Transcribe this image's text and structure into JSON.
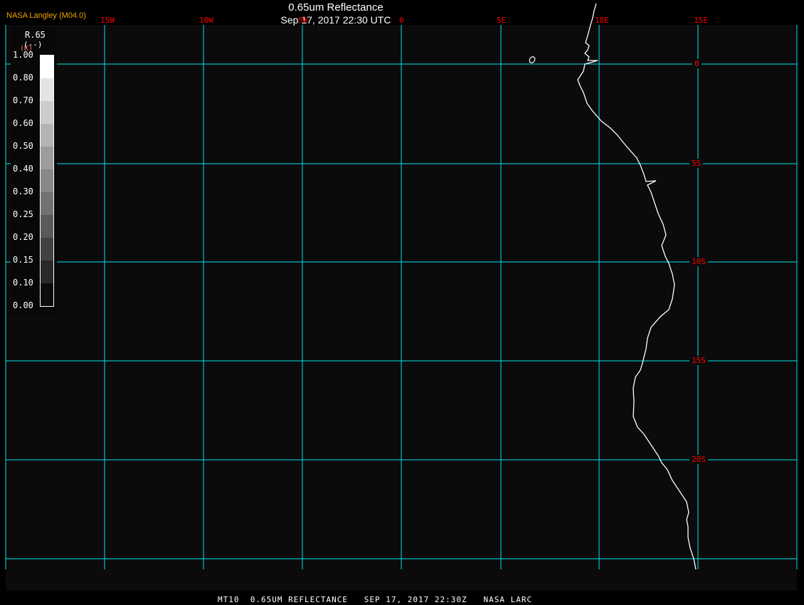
{
  "header": {
    "title": "0.65um Reflectance",
    "subtitle": "Sep 17, 2017 22:30 UTC",
    "brand": "NASA Langley (M04.0)"
  },
  "longitude_labels": [
    "15W",
    "10W",
    "5W",
    "0",
    "5E",
    "10E",
    "15E"
  ],
  "latitude_labels": [
    "0",
    "5S",
    "10S",
    "15S",
    "20S"
  ],
  "colorbar": {
    "variable": "R.65",
    "units": "(--)",
    "unit_k": "(K)",
    "labels": [
      "1.00",
      "0.80",
      "0.70",
      "0.60",
      "0.50",
      "0.40",
      "0.30",
      "0.25",
      "0.20",
      "0.15",
      "0.10",
      "0.00"
    ]
  },
  "footer": "MT10  0.65UM REFLECTANCE   SEP 17, 2017 22:30Z   NASA LARC",
  "colors": {
    "grid": "#00e5ee",
    "labels": "#ff0000",
    "brand": "#f5a300",
    "background": "#0b0b0b",
    "coast": "#ffffff"
  }
}
